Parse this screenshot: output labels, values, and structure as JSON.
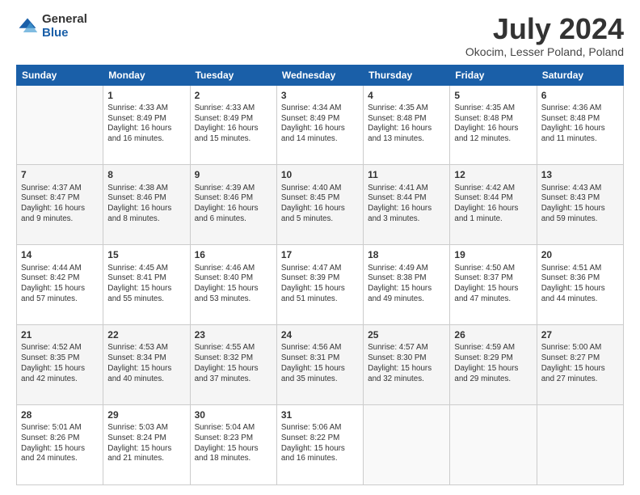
{
  "logo": {
    "general": "General",
    "blue": "Blue"
  },
  "header": {
    "title": "July 2024",
    "subtitle": "Okocim, Lesser Poland, Poland"
  },
  "weekdays": [
    "Sunday",
    "Monday",
    "Tuesday",
    "Wednesday",
    "Thursday",
    "Friday",
    "Saturday"
  ],
  "weeks": [
    [
      {
        "day": "",
        "info": ""
      },
      {
        "day": "1",
        "info": "Sunrise: 4:33 AM\nSunset: 8:49 PM\nDaylight: 16 hours\nand 16 minutes."
      },
      {
        "day": "2",
        "info": "Sunrise: 4:33 AM\nSunset: 8:49 PM\nDaylight: 16 hours\nand 15 minutes."
      },
      {
        "day": "3",
        "info": "Sunrise: 4:34 AM\nSunset: 8:49 PM\nDaylight: 16 hours\nand 14 minutes."
      },
      {
        "day": "4",
        "info": "Sunrise: 4:35 AM\nSunset: 8:48 PM\nDaylight: 16 hours\nand 13 minutes."
      },
      {
        "day": "5",
        "info": "Sunrise: 4:35 AM\nSunset: 8:48 PM\nDaylight: 16 hours\nand 12 minutes."
      },
      {
        "day": "6",
        "info": "Sunrise: 4:36 AM\nSunset: 8:48 PM\nDaylight: 16 hours\nand 11 minutes."
      }
    ],
    [
      {
        "day": "7",
        "info": "Sunrise: 4:37 AM\nSunset: 8:47 PM\nDaylight: 16 hours\nand 9 minutes."
      },
      {
        "day": "8",
        "info": "Sunrise: 4:38 AM\nSunset: 8:46 PM\nDaylight: 16 hours\nand 8 minutes."
      },
      {
        "day": "9",
        "info": "Sunrise: 4:39 AM\nSunset: 8:46 PM\nDaylight: 16 hours\nand 6 minutes."
      },
      {
        "day": "10",
        "info": "Sunrise: 4:40 AM\nSunset: 8:45 PM\nDaylight: 16 hours\nand 5 minutes."
      },
      {
        "day": "11",
        "info": "Sunrise: 4:41 AM\nSunset: 8:44 PM\nDaylight: 16 hours\nand 3 minutes."
      },
      {
        "day": "12",
        "info": "Sunrise: 4:42 AM\nSunset: 8:44 PM\nDaylight: 16 hours\nand 1 minute."
      },
      {
        "day": "13",
        "info": "Sunrise: 4:43 AM\nSunset: 8:43 PM\nDaylight: 15 hours\nand 59 minutes."
      }
    ],
    [
      {
        "day": "14",
        "info": "Sunrise: 4:44 AM\nSunset: 8:42 PM\nDaylight: 15 hours\nand 57 minutes."
      },
      {
        "day": "15",
        "info": "Sunrise: 4:45 AM\nSunset: 8:41 PM\nDaylight: 15 hours\nand 55 minutes."
      },
      {
        "day": "16",
        "info": "Sunrise: 4:46 AM\nSunset: 8:40 PM\nDaylight: 15 hours\nand 53 minutes."
      },
      {
        "day": "17",
        "info": "Sunrise: 4:47 AM\nSunset: 8:39 PM\nDaylight: 15 hours\nand 51 minutes."
      },
      {
        "day": "18",
        "info": "Sunrise: 4:49 AM\nSunset: 8:38 PM\nDaylight: 15 hours\nand 49 minutes."
      },
      {
        "day": "19",
        "info": "Sunrise: 4:50 AM\nSunset: 8:37 PM\nDaylight: 15 hours\nand 47 minutes."
      },
      {
        "day": "20",
        "info": "Sunrise: 4:51 AM\nSunset: 8:36 PM\nDaylight: 15 hours\nand 44 minutes."
      }
    ],
    [
      {
        "day": "21",
        "info": "Sunrise: 4:52 AM\nSunset: 8:35 PM\nDaylight: 15 hours\nand 42 minutes."
      },
      {
        "day": "22",
        "info": "Sunrise: 4:53 AM\nSunset: 8:34 PM\nDaylight: 15 hours\nand 40 minutes."
      },
      {
        "day": "23",
        "info": "Sunrise: 4:55 AM\nSunset: 8:32 PM\nDaylight: 15 hours\nand 37 minutes."
      },
      {
        "day": "24",
        "info": "Sunrise: 4:56 AM\nSunset: 8:31 PM\nDaylight: 15 hours\nand 35 minutes."
      },
      {
        "day": "25",
        "info": "Sunrise: 4:57 AM\nSunset: 8:30 PM\nDaylight: 15 hours\nand 32 minutes."
      },
      {
        "day": "26",
        "info": "Sunrise: 4:59 AM\nSunset: 8:29 PM\nDaylight: 15 hours\nand 29 minutes."
      },
      {
        "day": "27",
        "info": "Sunrise: 5:00 AM\nSunset: 8:27 PM\nDaylight: 15 hours\nand 27 minutes."
      }
    ],
    [
      {
        "day": "28",
        "info": "Sunrise: 5:01 AM\nSunset: 8:26 PM\nDaylight: 15 hours\nand 24 minutes."
      },
      {
        "day": "29",
        "info": "Sunrise: 5:03 AM\nSunset: 8:24 PM\nDaylight: 15 hours\nand 21 minutes."
      },
      {
        "day": "30",
        "info": "Sunrise: 5:04 AM\nSunset: 8:23 PM\nDaylight: 15 hours\nand 18 minutes."
      },
      {
        "day": "31",
        "info": "Sunrise: 5:06 AM\nSunset: 8:22 PM\nDaylight: 15 hours\nand 16 minutes."
      },
      {
        "day": "",
        "info": ""
      },
      {
        "day": "",
        "info": ""
      },
      {
        "day": "",
        "info": ""
      }
    ]
  ]
}
